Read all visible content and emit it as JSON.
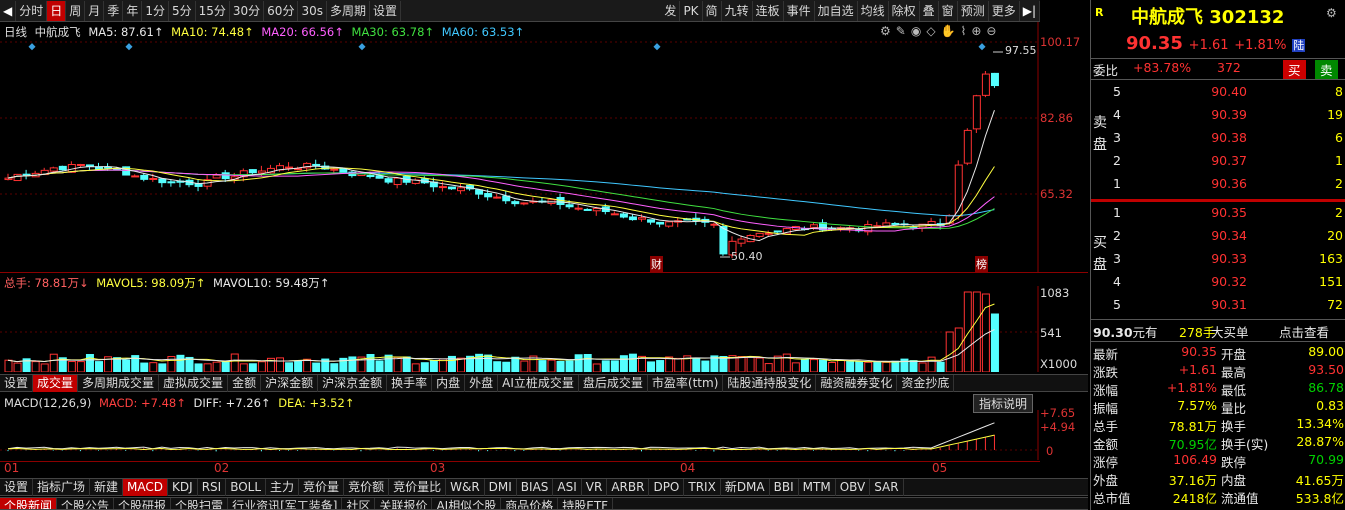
{
  "toolbar": {
    "left": [
      "分时",
      "日",
      "周",
      "月",
      "季",
      "年",
      "1分",
      "5分",
      "15分",
      "30分",
      "60分",
      "30s",
      "多周期",
      "设置"
    ],
    "right": [
      "发",
      "PK",
      "简",
      "九转",
      "连板",
      "事件",
      "加自选",
      "均线",
      "除权",
      "叠",
      "窗",
      "预测",
      "更多"
    ]
  },
  "ma": {
    "period": "日线",
    "name": "中航成飞",
    "ma5": "MA5: 87.61↑",
    "ma10": "MA10: 74.48↑",
    "ma20": "MA20: 66.56↑",
    "ma30": "MA30: 63.78↑",
    "ma60": "MA60: 63.53↑"
  },
  "price_axis": [
    "100.17",
    "82.86",
    "65.32"
  ],
  "annotations": {
    "high": "97.55",
    "low": "50.40",
    "cai": "财",
    "bang": "榜"
  },
  "vol": {
    "total": "总手: 78.81万↓",
    "mavol5": "MAVOL5: 98.09万↑",
    "mavol10": "MAVOL10: 59.48万↑",
    "axis": [
      "1083",
      "541"
    ],
    "unit": "X1000"
  },
  "tabs1": [
    "设置",
    "成交量",
    "多周期成交量",
    "虚拟成交量",
    "金额",
    "沪深金额",
    "沪深京金额",
    "换手率",
    "内盘",
    "外盘",
    "AI立桩成交量",
    "盘后成交量",
    "市盈率(ttm)",
    "陆股通持股变化",
    "融资融券变化",
    "资金抄底"
  ],
  "macd": {
    "label": "MACD(12,26,9)",
    "macd": "MACD: +7.48↑",
    "diff": "DIFF: +7.26↑",
    "dea": "DEA: +3.52↑",
    "axis": [
      "+7.65",
      "+4.94",
      "0"
    ],
    "help": "指标说明"
  },
  "months": [
    "01",
    "02",
    "03",
    "04",
    "05"
  ],
  "tabs2": [
    "设置",
    "指标广场",
    "新建",
    "MACD",
    "KDJ",
    "RSI",
    "BOLL",
    "主力",
    "竞价量",
    "竞价额",
    "竞价量比",
    "W&R",
    "DMI",
    "BIAS",
    "ASI",
    "VR",
    "ARBR",
    "DPO",
    "TRIX",
    "新DMA",
    "BBI",
    "MTM",
    "OBV",
    "SAR"
  ],
  "tabs3": [
    "个股新闻",
    "个股公告",
    "个股研报",
    "个股扫雷",
    "行业资讯[军工装备]",
    "社区",
    "关联报价",
    "AI相似个股",
    "商品价格",
    "持股ETF"
  ],
  "quote": {
    "name": "中航成飞",
    "code": "302132",
    "price": "90.35",
    "change": "+1.61",
    "pct": "+1.81%",
    "tag": "陆",
    "weibi_label": "委比",
    "weibi": "+83.78%",
    "weicha": "372",
    "buy": "买",
    "sell": "卖"
  },
  "asks": [
    {
      "n": "5",
      "p": "90.40",
      "v": "8"
    },
    {
      "n": "4",
      "p": "90.39",
      "v": "19"
    },
    {
      "n": "3",
      "p": "90.38",
      "v": "6"
    },
    {
      "n": "2",
      "p": "90.37",
      "v": "1"
    },
    {
      "n": "1",
      "p": "90.36",
      "v": "2"
    }
  ],
  "bids": [
    {
      "n": "1",
      "p": "90.35",
      "v": "2"
    },
    {
      "n": "2",
      "p": "90.34",
      "v": "20"
    },
    {
      "n": "3",
      "p": "90.33",
      "v": "163"
    },
    {
      "n": "4",
      "p": "90.32",
      "v": "151"
    },
    {
      "n": "5",
      "p": "90.31",
      "v": "72"
    }
  ],
  "ask_label": [
    "卖",
    "盘"
  ],
  "bid_label": [
    "买",
    "盘"
  ],
  "bigorder": {
    "price": "90.30",
    "unit": "元有",
    "vol": "278手",
    "type": "大买单",
    "link": "点击查看"
  },
  "stats": [
    [
      "最新",
      "90.35",
      "开盘",
      "89.00"
    ],
    [
      "涨跌",
      "+1.61",
      "最高",
      "93.50"
    ],
    [
      "涨幅",
      "+1.81%",
      "最低",
      "86.78"
    ],
    [
      "振幅",
      "7.57%",
      "量比",
      "0.83"
    ],
    [
      "总手",
      "78.81万",
      "换手",
      "13.34%"
    ],
    [
      "金额",
      "70.95亿",
      "换手(实)",
      "28.87%"
    ],
    [
      "涨停",
      "106.49",
      "跌停",
      "70.99"
    ],
    [
      "外盘",
      "37.16万",
      "内盘",
      "41.65万"
    ],
    [
      "总市值",
      "2418亿",
      "流通值",
      "533.8亿"
    ]
  ]
}
